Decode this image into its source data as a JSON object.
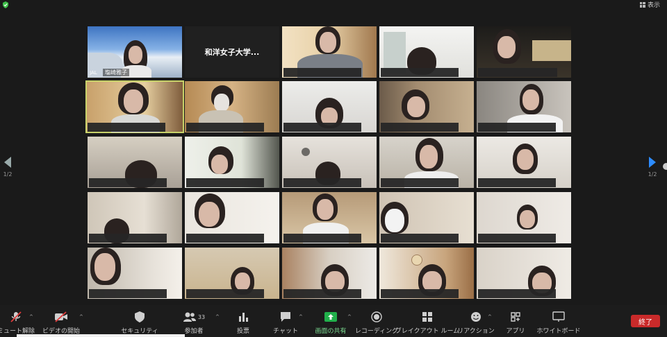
{
  "top": {
    "view_label": "表示"
  },
  "pager": {
    "left_page": "1/2",
    "right_page": "1/2"
  },
  "tiles": {
    "t0": {
      "name": "塩崎雅子",
      "logo": "JAL"
    },
    "t1": {
      "name": "和洋女子大学..."
    }
  },
  "toolbar": {
    "mute": "ミュート解除",
    "video": "ビデオの開始",
    "security": "セキュリティ",
    "participants": "参加者",
    "participants_count": "33",
    "polls": "投票",
    "chat": "チャット",
    "share": "画面の共有",
    "record": "レコーディング",
    "breakout": "ブレイクアウト ルーム",
    "reactions": "リアクション",
    "apps": "アプリ",
    "whiteboard": "ホワイトボード",
    "end": "終了"
  },
  "colors": {
    "share_green": "#21b04b",
    "end_red": "#c92a2a",
    "active_outline": "#c9d36a",
    "pager_blue": "#2d8cff"
  }
}
